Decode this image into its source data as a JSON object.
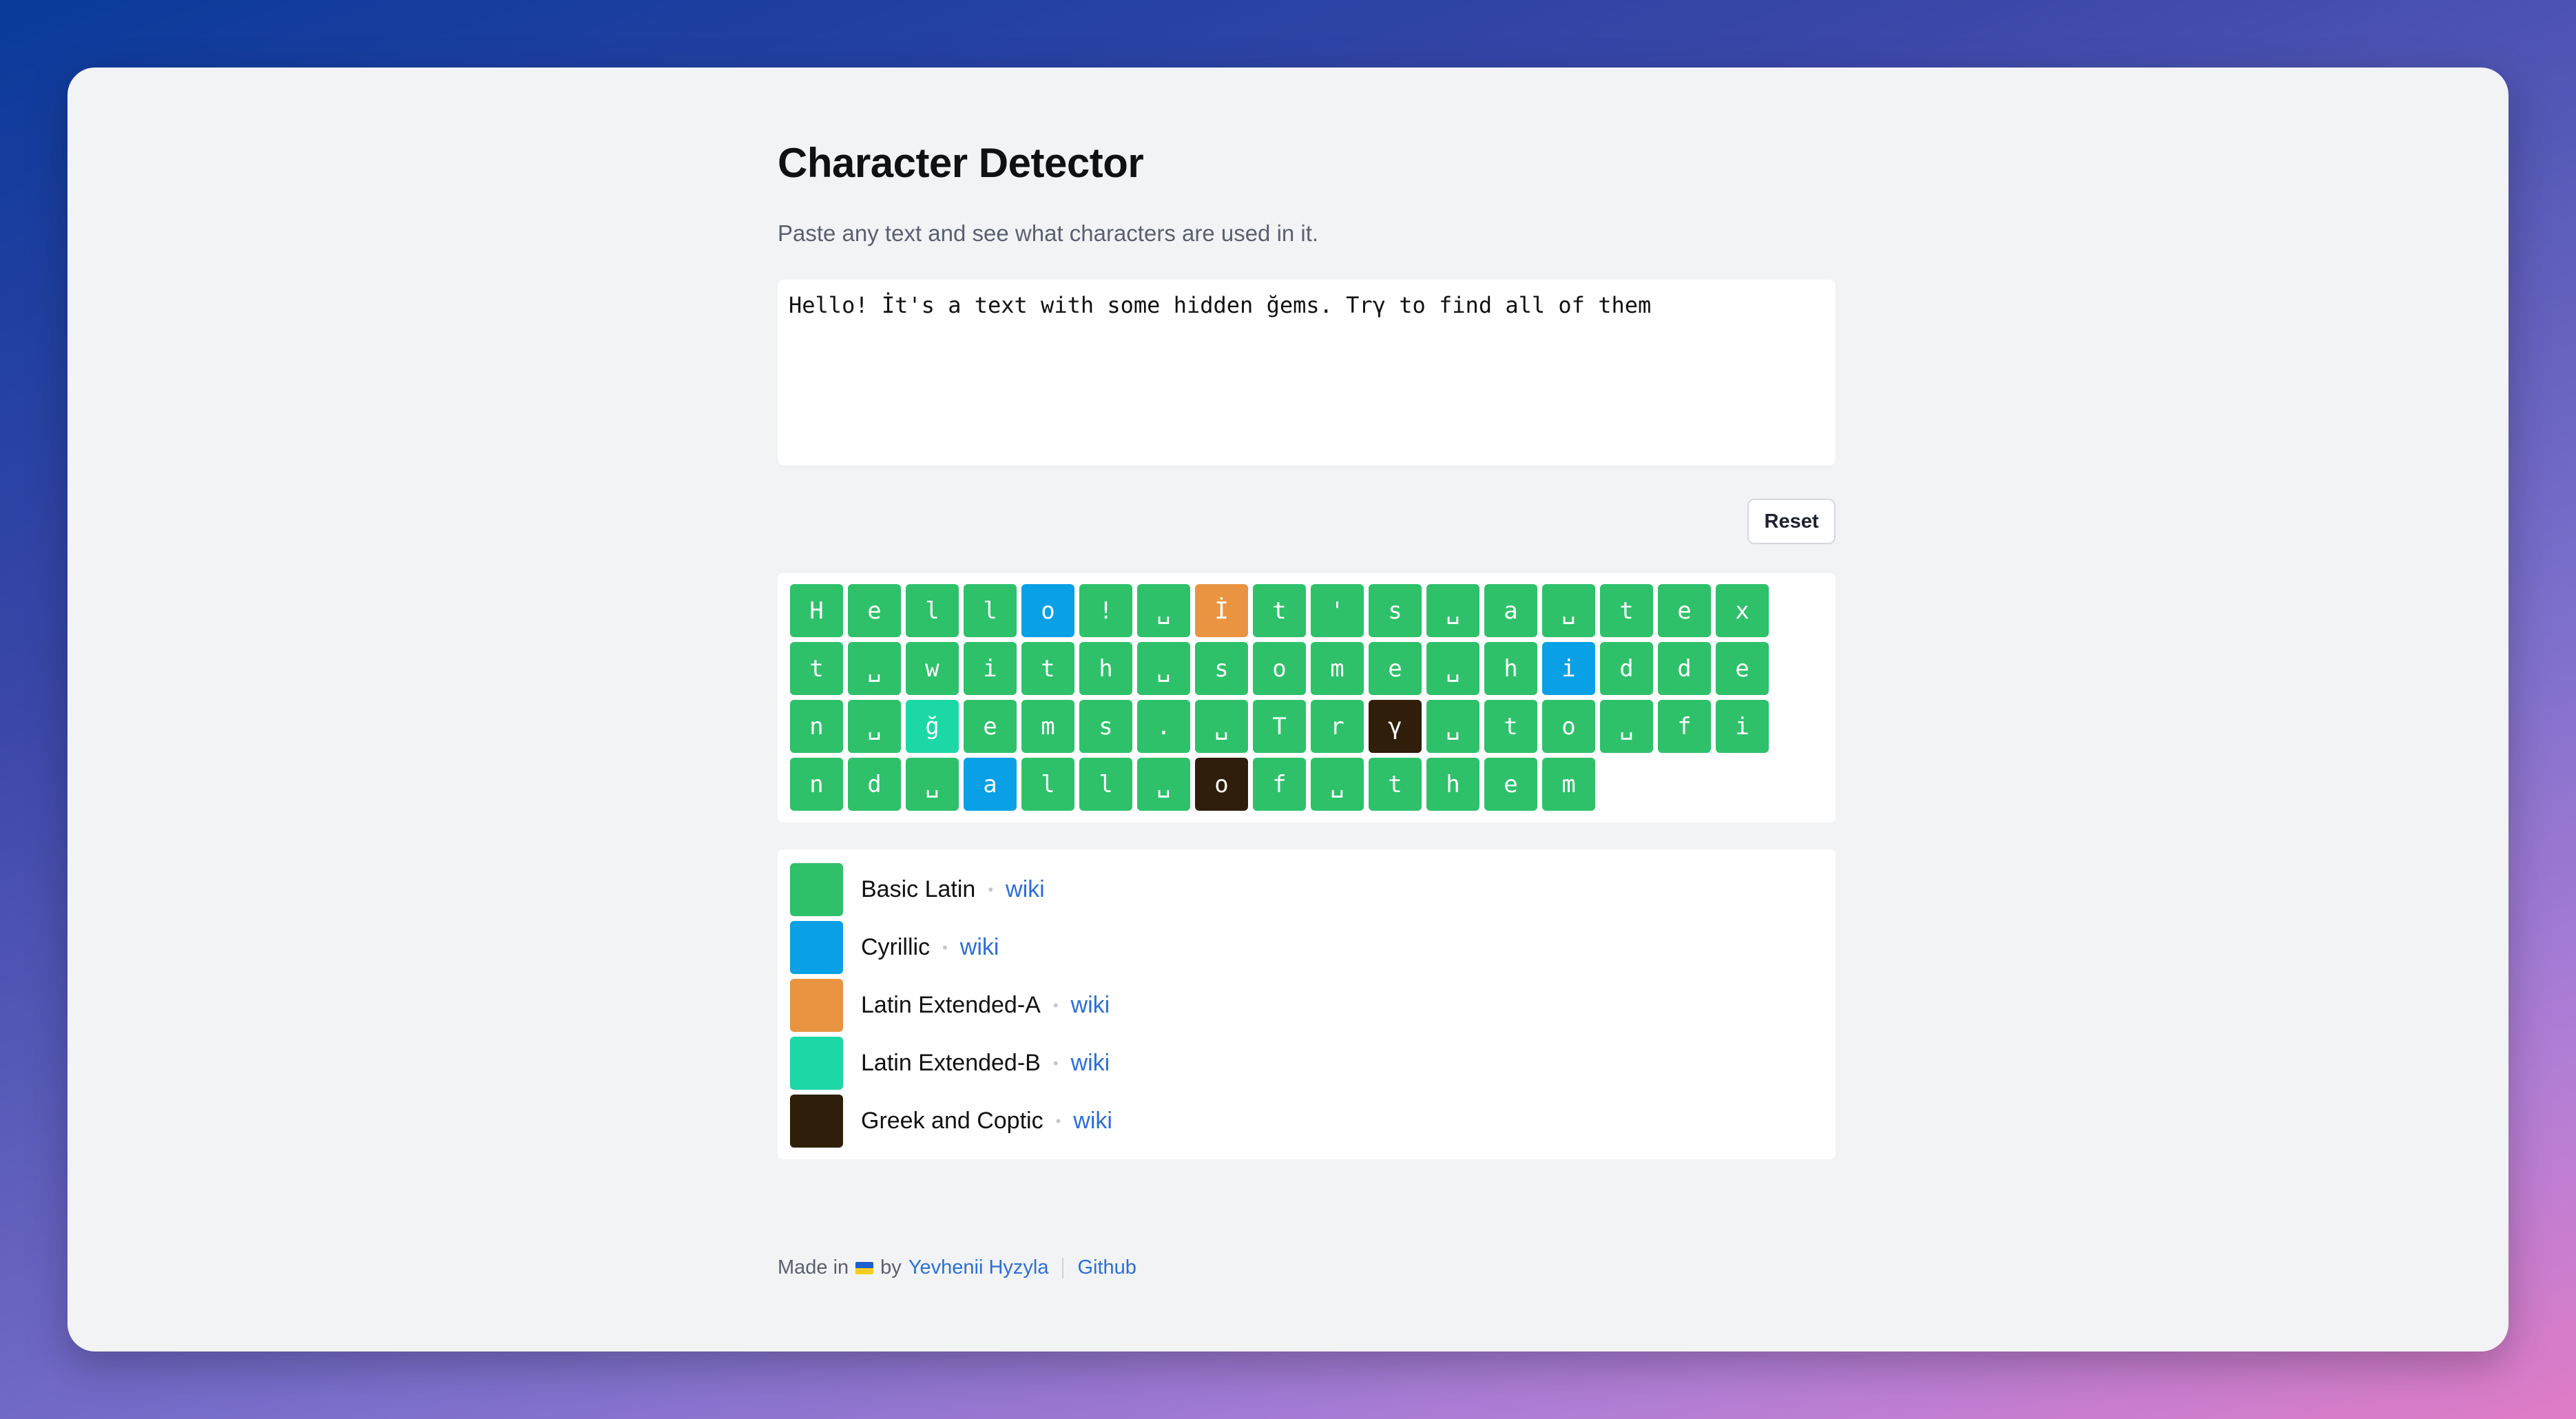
{
  "header": {
    "title": "Character Detector",
    "subtitle": "Paste any text and see what characters are used in it."
  },
  "input": {
    "value": "Hello! İt's a text with some hidden ğems. Trγ to find all of them"
  },
  "controls": {
    "reset_label": "Reset"
  },
  "colors": {
    "basic_latin": "#2ec16a",
    "cyrillic": "#0aa0e6",
    "latin_ext_a": "#ea9442",
    "latin_ext_b": "#1bd8a6",
    "greek": "#2f1f0a"
  },
  "characters": [
    {
      "c": "H",
      "b": "basic_latin"
    },
    {
      "c": "e",
      "b": "basic_latin"
    },
    {
      "c": "l",
      "b": "basic_latin"
    },
    {
      "c": "l",
      "b": "basic_latin"
    },
    {
      "c": "o",
      "b": "cyrillic"
    },
    {
      "c": "!",
      "b": "basic_latin"
    },
    {
      "c": "␣",
      "b": "basic_latin"
    },
    {
      "c": "İ",
      "b": "latin_ext_a"
    },
    {
      "c": "t",
      "b": "basic_latin"
    },
    {
      "c": "'",
      "b": "basic_latin"
    },
    {
      "c": "s",
      "b": "basic_latin"
    },
    {
      "c": "␣",
      "b": "basic_latin"
    },
    {
      "c": "a",
      "b": "basic_latin"
    },
    {
      "c": "␣",
      "b": "basic_latin"
    },
    {
      "c": "t",
      "b": "basic_latin"
    },
    {
      "c": "e",
      "b": "basic_latin"
    },
    {
      "c": "x",
      "b": "basic_latin"
    },
    {
      "c": "t",
      "b": "basic_latin"
    },
    {
      "c": "␣",
      "b": "basic_latin"
    },
    {
      "c": "w",
      "b": "basic_latin"
    },
    {
      "c": "i",
      "b": "basic_latin"
    },
    {
      "c": "t",
      "b": "basic_latin"
    },
    {
      "c": "h",
      "b": "basic_latin"
    },
    {
      "c": "␣",
      "b": "basic_latin"
    },
    {
      "c": "s",
      "b": "basic_latin"
    },
    {
      "c": "o",
      "b": "basic_latin"
    },
    {
      "c": "m",
      "b": "basic_latin"
    },
    {
      "c": "e",
      "b": "basic_latin"
    },
    {
      "c": "␣",
      "b": "basic_latin"
    },
    {
      "c": "h",
      "b": "basic_latin"
    },
    {
      "c": "i",
      "b": "cyrillic"
    },
    {
      "c": "d",
      "b": "basic_latin"
    },
    {
      "c": "d",
      "b": "basic_latin"
    },
    {
      "c": "e",
      "b": "basic_latin"
    },
    {
      "c": "n",
      "b": "basic_latin"
    },
    {
      "c": "␣",
      "b": "basic_latin"
    },
    {
      "c": "ğ",
      "b": "latin_ext_b"
    },
    {
      "c": "e",
      "b": "basic_latin"
    },
    {
      "c": "m",
      "b": "basic_latin"
    },
    {
      "c": "s",
      "b": "basic_latin"
    },
    {
      "c": ".",
      "b": "basic_latin"
    },
    {
      "c": "␣",
      "b": "basic_latin"
    },
    {
      "c": "T",
      "b": "basic_latin"
    },
    {
      "c": "r",
      "b": "basic_latin"
    },
    {
      "c": "γ",
      "b": "greek"
    },
    {
      "c": "␣",
      "b": "basic_latin"
    },
    {
      "c": "t",
      "b": "basic_latin"
    },
    {
      "c": "o",
      "b": "basic_latin"
    },
    {
      "c": "␣",
      "b": "basic_latin"
    },
    {
      "c": "f",
      "b": "basic_latin"
    },
    {
      "c": "i",
      "b": "basic_latin"
    },
    {
      "c": "n",
      "b": "basic_latin"
    },
    {
      "c": "d",
      "b": "basic_latin"
    },
    {
      "c": "␣",
      "b": "basic_latin"
    },
    {
      "c": "a",
      "b": "cyrillic"
    },
    {
      "c": "l",
      "b": "basic_latin"
    },
    {
      "c": "l",
      "b": "basic_latin"
    },
    {
      "c": "␣",
      "b": "basic_latin"
    },
    {
      "c": "o",
      "b": "greek"
    },
    {
      "c": "f",
      "b": "basic_latin"
    },
    {
      "c": "␣",
      "b": "basic_latin"
    },
    {
      "c": "t",
      "b": "basic_latin"
    },
    {
      "c": "h",
      "b": "basic_latin"
    },
    {
      "c": "e",
      "b": "basic_latin"
    },
    {
      "c": "m",
      "b": "basic_latin"
    }
  ],
  "legend": [
    {
      "name": "Basic Latin",
      "color": "#2ec16a",
      "link": "wiki"
    },
    {
      "name": "Cyrillic",
      "color": "#0aa0e6",
      "link": "wiki"
    },
    {
      "name": "Latin Extended-A",
      "color": "#ea9442",
      "link": "wiki"
    },
    {
      "name": "Latin Extended-B",
      "color": "#1bd8a6",
      "link": "wiki"
    },
    {
      "name": "Greek and Coptic",
      "color": "#2f1f0a",
      "link": "wiki"
    }
  ],
  "footer": {
    "made_in": "Made in",
    "by": "by",
    "author": "Yevhenii Hyzyla",
    "github": "Github"
  }
}
